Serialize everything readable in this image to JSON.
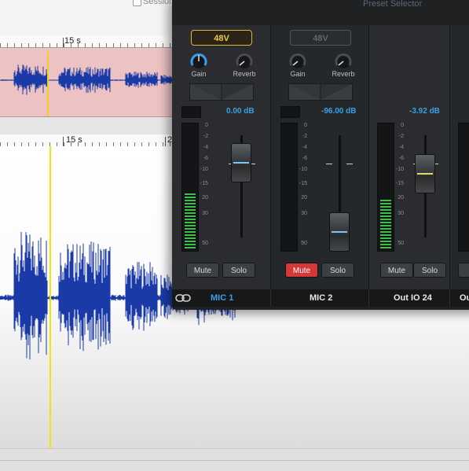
{
  "session_label": "Session",
  "ruler": {
    "overview_label": "15 s",
    "main_label": "15 s",
    "main_label_partial": "2"
  },
  "colors": {
    "overview_bg": "#ecc2c2",
    "waveform": "#1a3aa8",
    "playhead": "#f2d11c",
    "accent_blue": "#3b9fe8",
    "phantom_amber": "#e2b53e",
    "mute_red": "#d43838",
    "meter_green": "#3fbe4a"
  },
  "mixer": {
    "title": "Preset Selector",
    "link_icon": "link-icon",
    "meter_scale": [
      "0",
      "-2",
      "-4",
      "-6",
      "-10",
      "-15",
      "20",
      "30",
      "50"
    ],
    "channels": [
      {
        "name": "MIC 1",
        "phantom_label": "48V",
        "phantom_on": true,
        "gain_label": "Gain",
        "reverb_label": "Reverb",
        "gain_knob_active": true,
        "db": "0.00 dB",
        "mute_label": "Mute",
        "solo_label": "Solo",
        "muted": false,
        "meter_level": 0.46
      },
      {
        "name": "MIC 2",
        "phantom_label": "48V",
        "phantom_on": false,
        "gain_label": "Gain",
        "reverb_label": "Reverb",
        "gain_knob_active": false,
        "db": "-96.00 dB",
        "mute_label": "Mute",
        "solo_label": "Solo",
        "muted": true,
        "meter_level": 0
      },
      {
        "name": "Out IO 24",
        "db": "-3.92 dB",
        "mute_label": "Mute",
        "solo_label": "Solo",
        "muted": false,
        "meter_level": 0.41
      },
      {
        "name": "Ou",
        "mute_label": "M"
      }
    ]
  }
}
